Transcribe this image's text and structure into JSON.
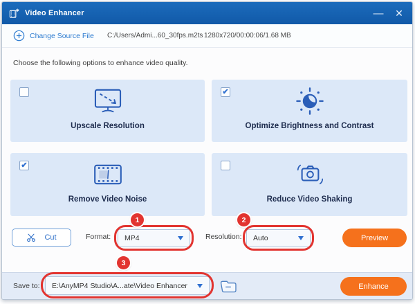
{
  "window": {
    "title": "Video Enhancer",
    "minimize_glyph": "—",
    "close_glyph": "✕"
  },
  "toolbar": {
    "change_source_label": "Change Source File",
    "file_path": "C:/Users/Admi...60_30fps.m2ts",
    "file_info": "1280x720/00:00:06/1.68 MB"
  },
  "main": {
    "instruction": "Choose the following options to enhance video quality."
  },
  "options": [
    {
      "label": "Upscale Resolution",
      "checked": false,
      "check_glyph": "",
      "icon": "monitor-upscale-icon"
    },
    {
      "label": "Optimize Brightness and Contrast",
      "checked": true,
      "check_glyph": "✔",
      "icon": "brightness-contrast-icon"
    },
    {
      "label": "Remove Video Noise",
      "checked": true,
      "check_glyph": "✔",
      "icon": "film-noise-icon"
    },
    {
      "label": "Reduce Video Shaking",
      "checked": false,
      "check_glyph": "",
      "icon": "camera-shake-icon"
    }
  ],
  "controls": {
    "cut_label": "Cut",
    "format_label": "Format:",
    "format_value": "MP4",
    "resolution_label": "Resolution:",
    "resolution_value": "Auto",
    "preview_label": "Preview"
  },
  "save": {
    "label": "Save to:",
    "path": "E:\\AnyMP4 Studio\\A...ate\\Video Enhancer",
    "enhance_label": "Enhance"
  },
  "annotations": {
    "step1": "1",
    "step2": "2",
    "step3": "3"
  },
  "colors": {
    "titlebar_blue": "#1763B2",
    "accent_blue": "#2E7CD0",
    "card_bg": "#DCE8F8",
    "icon_blue": "#2B5EB8",
    "button_orange": "#F5711C",
    "annotation_red": "#E23430",
    "savebar_bg": "#E3EBF7"
  }
}
